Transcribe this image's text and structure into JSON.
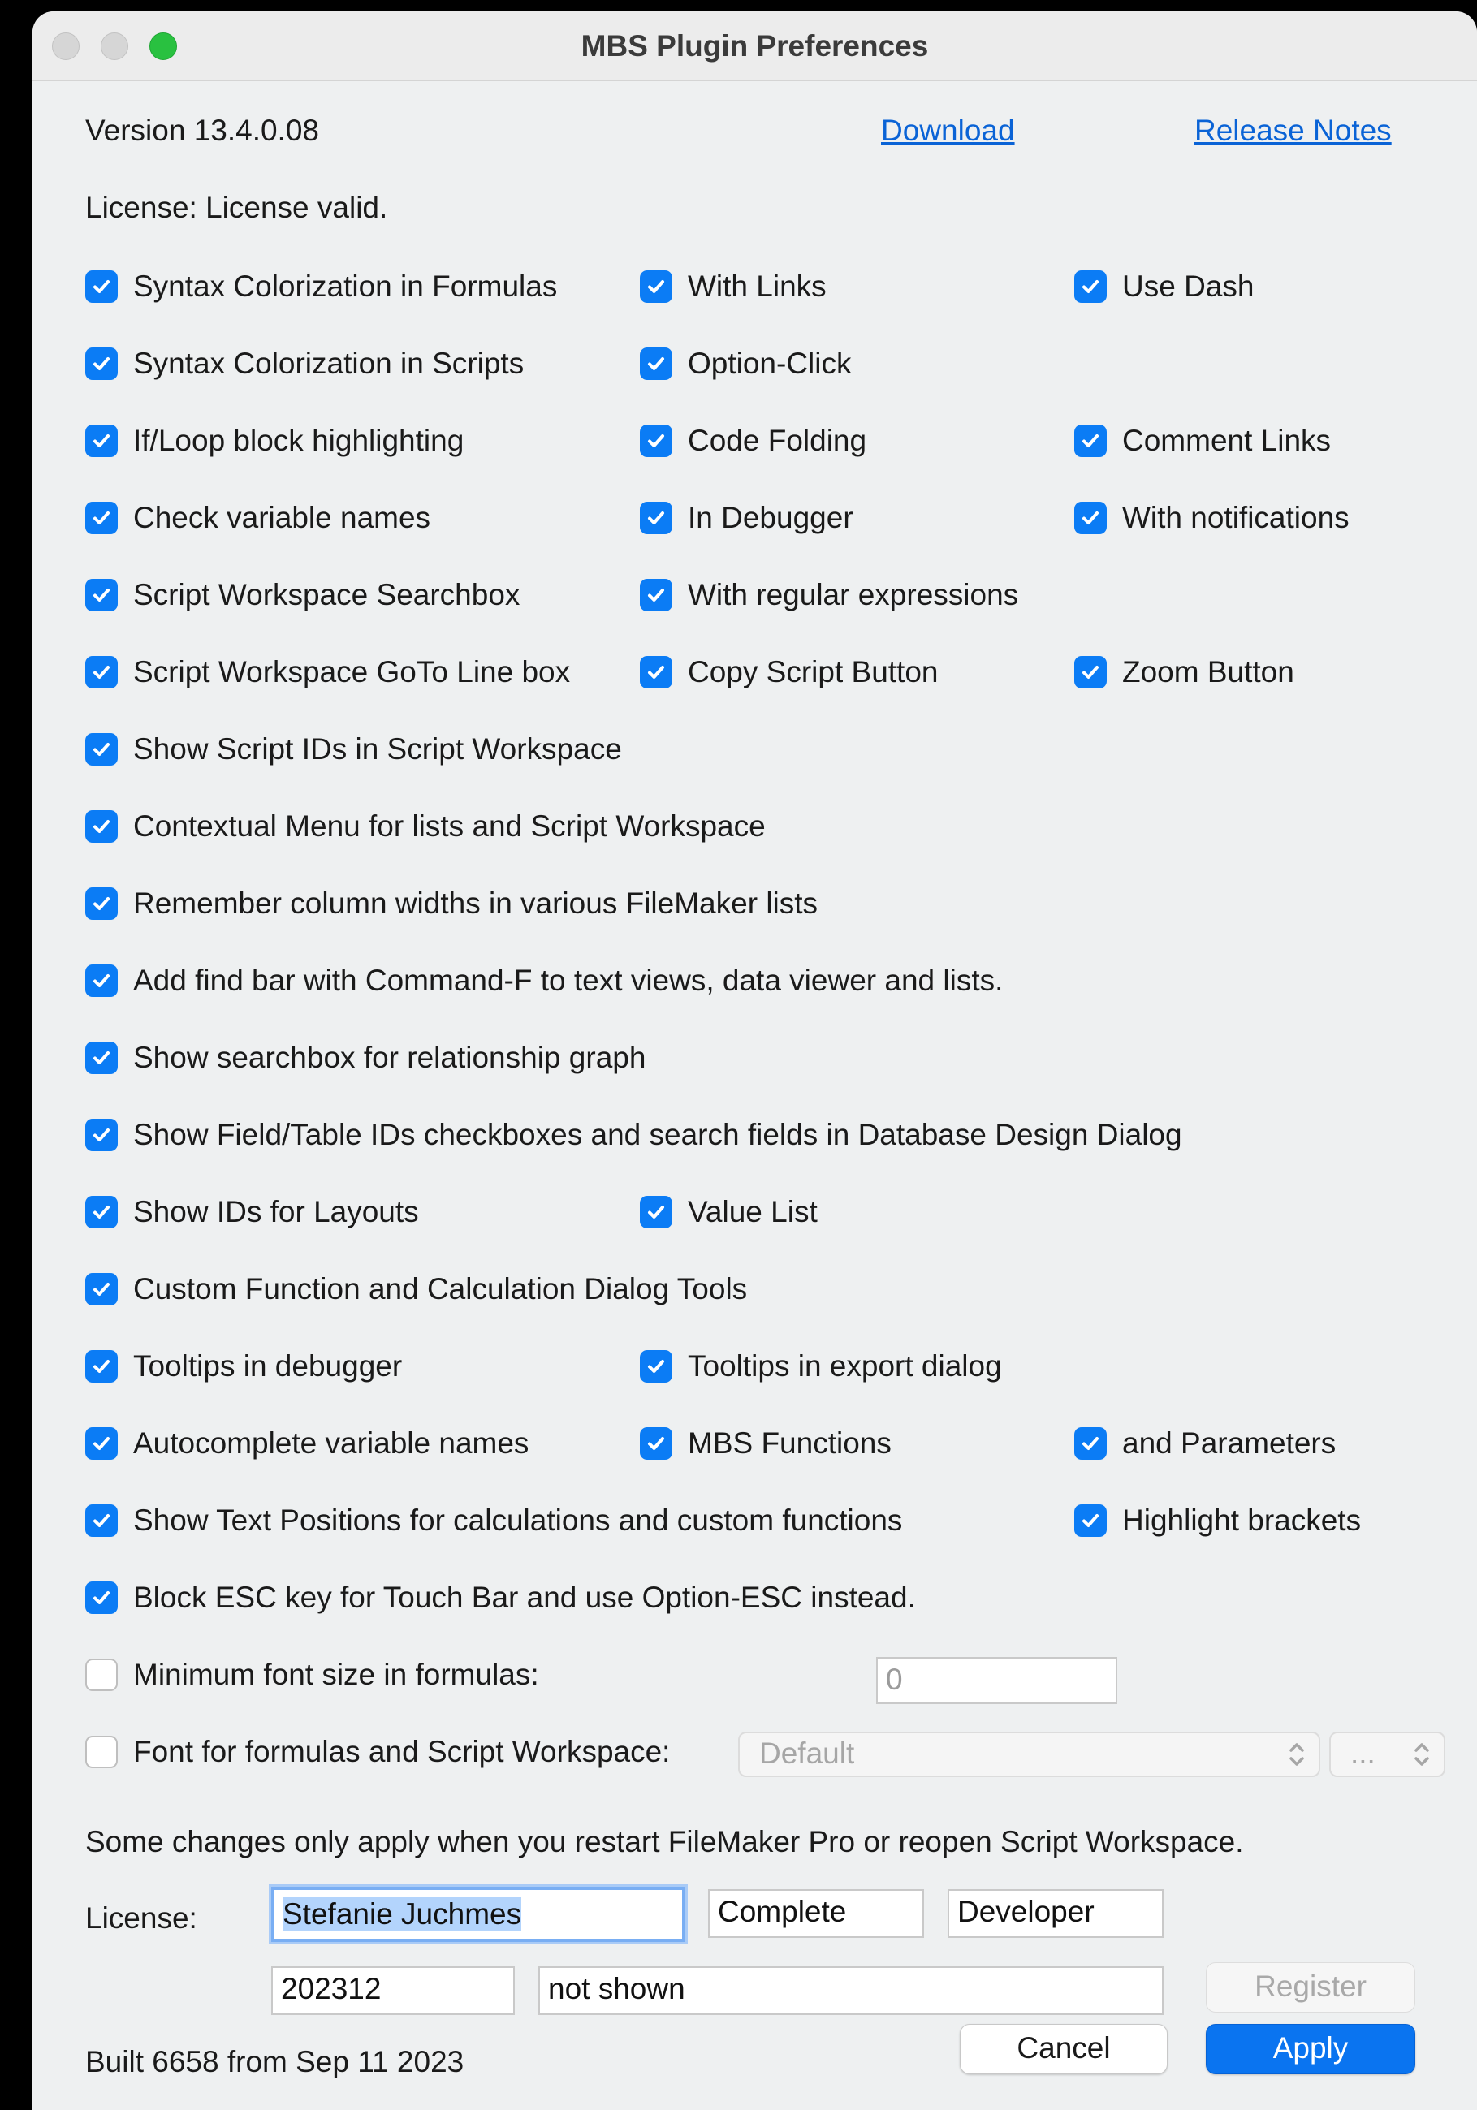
{
  "window": {
    "title": "MBS Plugin Preferences"
  },
  "header": {
    "version": "Version 13.4.0.08",
    "download_label": "Download",
    "release_notes_label": "Release Notes",
    "license_status": "License: License valid."
  },
  "options": {
    "syntax_formulas": "Syntax Colorization in Formulas",
    "with_links": "With Links",
    "use_dash": "Use Dash",
    "syntax_scripts": "Syntax Colorization in Scripts",
    "option_click": "Option-Click",
    "if_loop": "If/Loop block highlighting",
    "code_folding": "Code Folding",
    "comment_links": "Comment Links",
    "check_variable": "Check variable names",
    "in_debugger": "In Debugger",
    "with_notifications": "With notifications",
    "workspace_searchbox": "Script Workspace Searchbox",
    "with_regex": "With regular expressions",
    "goto_line": "Script Workspace GoTo Line box",
    "copy_script": "Copy Script Button",
    "zoom_button": "Zoom Button",
    "show_script_ids": "Show Script IDs in Script Workspace",
    "contextual_menu": "Contextual Menu for lists and Script Workspace",
    "remember_widths": "Remember column widths in various FileMaker lists",
    "find_bar": "Add find bar with Command-F to text views, data viewer and lists.",
    "searchbox_graph": "Show searchbox for relationship graph",
    "field_table_ids": "Show Field/Table IDs checkboxes and search fields in Database Design Dialog",
    "ids_layouts": "Show IDs for Layouts",
    "value_list": "Value List",
    "custom_function_tools": "Custom Function and Calculation Dialog Tools",
    "tooltips_debugger": "Tooltips in debugger",
    "tooltips_export": "Tooltips in export dialog",
    "autocomplete": "Autocomplete variable names",
    "mbs_functions": "MBS Functions",
    "and_parameters": "and Parameters",
    "text_positions": "Show Text Positions for calculations and custom functions",
    "highlight_brackets": "Highlight brackets",
    "block_esc": "Block ESC key for Touch Bar and use Option-ESC instead.",
    "min_font_size": "Minimum font size in formulas:",
    "font_formulas": "Font for formulas and Script Workspace:"
  },
  "font_settings": {
    "min_size_value": "0",
    "font_select": "Default",
    "size_select": "..."
  },
  "notice": "Some changes only apply when you restart FileMaker Pro or reopen Script Workspace.",
  "license_form": {
    "label": "License:",
    "name": "Stefanie Juchmes",
    "type": "Complete",
    "edition": "Developer",
    "date": "202312",
    "key": "not shown",
    "register_label": "Register"
  },
  "footer": {
    "built": "Built 6658 from Sep 11 2023",
    "cancel_label": "Cancel",
    "apply_label": "Apply"
  },
  "colors": {
    "accent": "#0b7cf5",
    "link": "#0a63d6",
    "window_bg": "#eef0f1"
  },
  "icons": {
    "checkbox_checked": "checkmark-icon",
    "popup_arrows": "chevron-up-down-icon"
  }
}
